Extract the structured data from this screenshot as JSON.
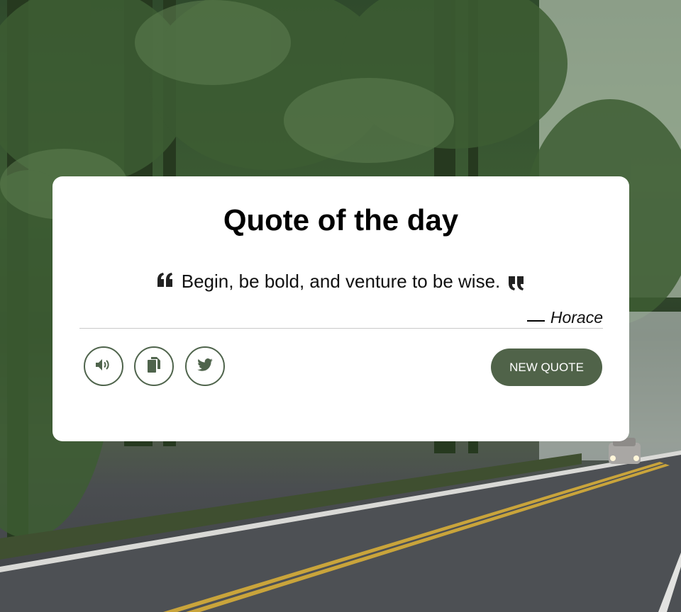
{
  "card": {
    "title": "Quote of the day",
    "quote": "Begin, be bold, and venture to be wise.",
    "author": "Horace"
  },
  "actions": {
    "speak_icon": "speaker-icon",
    "copy_icon": "copy-icon",
    "twitter_icon": "twitter-icon",
    "new_quote_label": "NEW QUOTE"
  },
  "colors": {
    "accent": "#506349",
    "card_background": "#ffffff"
  }
}
